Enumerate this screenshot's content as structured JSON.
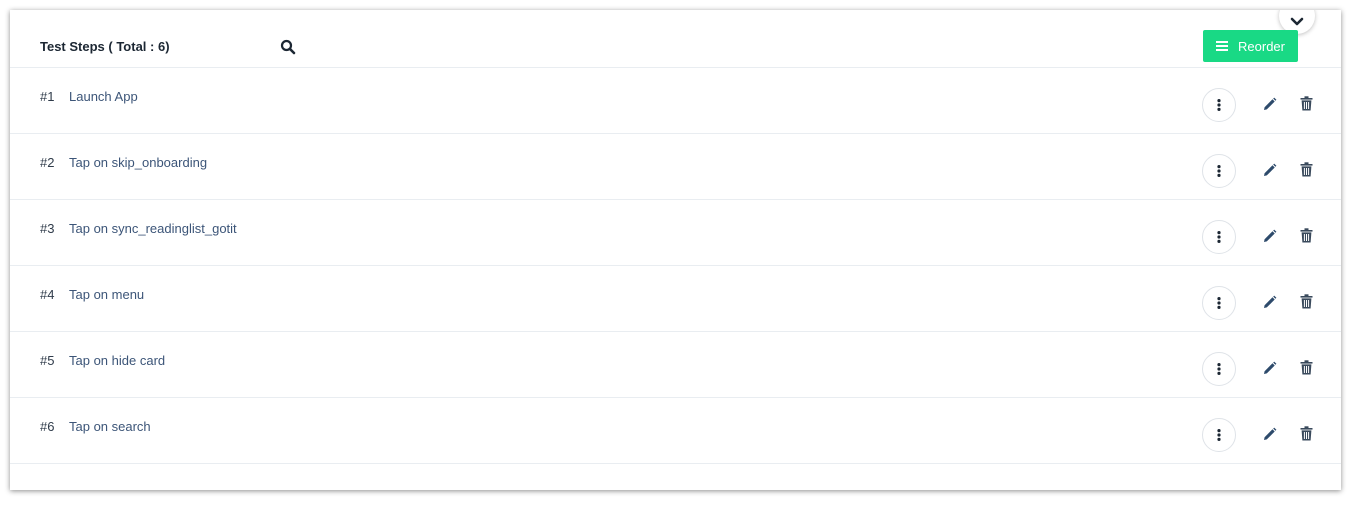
{
  "header": {
    "title": "Test Steps ( Total : 6)",
    "reorder_label": "Reorder",
    "reorder_color": "#19d985"
  },
  "icons": {
    "search": "search-icon",
    "collapse": "chevron-down-icon",
    "reorder": "hamburger-icon",
    "more": "vertical-dots-icon",
    "edit": "pencil-icon",
    "delete": "trash-icon"
  },
  "steps": [
    {
      "number": "#1",
      "text": "Launch App"
    },
    {
      "number": "#2",
      "text": "Tap on skip_onboarding"
    },
    {
      "number": "#3",
      "text": "Tap on sync_readinglist_gotit"
    },
    {
      "number": "#4",
      "text": "Tap on menu"
    },
    {
      "number": "#5",
      "text": "Tap on hide card"
    },
    {
      "number": "#6",
      "text": "Tap on search"
    }
  ]
}
